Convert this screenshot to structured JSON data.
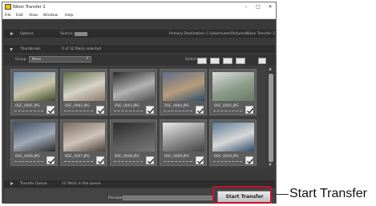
{
  "window": {
    "title": "Nikon Transfer 2",
    "controls": [
      "–",
      "□",
      "✕"
    ]
  },
  "menu": [
    "File",
    "Edit",
    "View",
    "Window",
    "Help"
  ],
  "options_bar": {
    "label": "Options",
    "source_label": "Source:",
    "destination": "Primary Destination: C:\\Users\\user\\Pictures\\Nikon Transfer 2"
  },
  "thumbnails_bar": {
    "label": "Thumbnails",
    "selected_text": "0 of 12 file(s) selected"
  },
  "toolbar": {
    "group_label": "Group:",
    "group_value": "None",
    "select_label": "Select:"
  },
  "thumbnails": [
    {
      "name": "DSC_0001.JPG",
      "colors": [
        "#6f8fb3",
        "#c9c4a8",
        "#3d4a2a"
      ]
    },
    {
      "name": "DSC_0002.JPG",
      "colors": [
        "#5d6b49",
        "#d8d2c8",
        "#8a7a6a"
      ]
    },
    {
      "name": "DSC_0003.JPG",
      "colors": [
        "#2b2b2b",
        "#b3b3b3",
        "#4e4e4e"
      ]
    },
    {
      "name": "DSC_0004.JPG",
      "colors": [
        "#5f6f88",
        "#b79c7a",
        "#2c4d6a"
      ]
    },
    {
      "name": "DSC_0005.JPG",
      "colors": [
        "#dcdcdc",
        "#8a9b8a",
        "#6a7b6a"
      ]
    },
    {
      "name": "DSC_0006.JPG",
      "colors": [
        "#3f4f63",
        "#9fa9b6",
        "#2a2a2a"
      ]
    },
    {
      "name": "DSC_0007.JPG",
      "colors": [
        "#7b6e62",
        "#cfc4b8",
        "#4a3f38"
      ]
    },
    {
      "name": "DSC_0008.JPG",
      "colors": [
        "#2a2a2a",
        "#5a5a5a",
        "#777777"
      ]
    },
    {
      "name": "DSC_0009.JPG",
      "colors": [
        "#eaeaea",
        "#8c8c8c",
        "#444444"
      ]
    },
    {
      "name": "DSC_0010.JPG",
      "colors": [
        "#5f7b95",
        "#d8d8d8",
        "#2b4a66"
      ]
    }
  ],
  "transfer_queue_bar": {
    "label": "Transfer Queue",
    "queue_text": "12 file(s) in the queue"
  },
  "bottom": {
    "preview_label": "Preview:",
    "start_button": "Start Transfer"
  },
  "callout": {
    "text": "Start Transfer"
  },
  "colors": {
    "highlight": "#c8102e",
    "window_bg": "#3a3a3a",
    "accent_title": "#f3c400"
  }
}
